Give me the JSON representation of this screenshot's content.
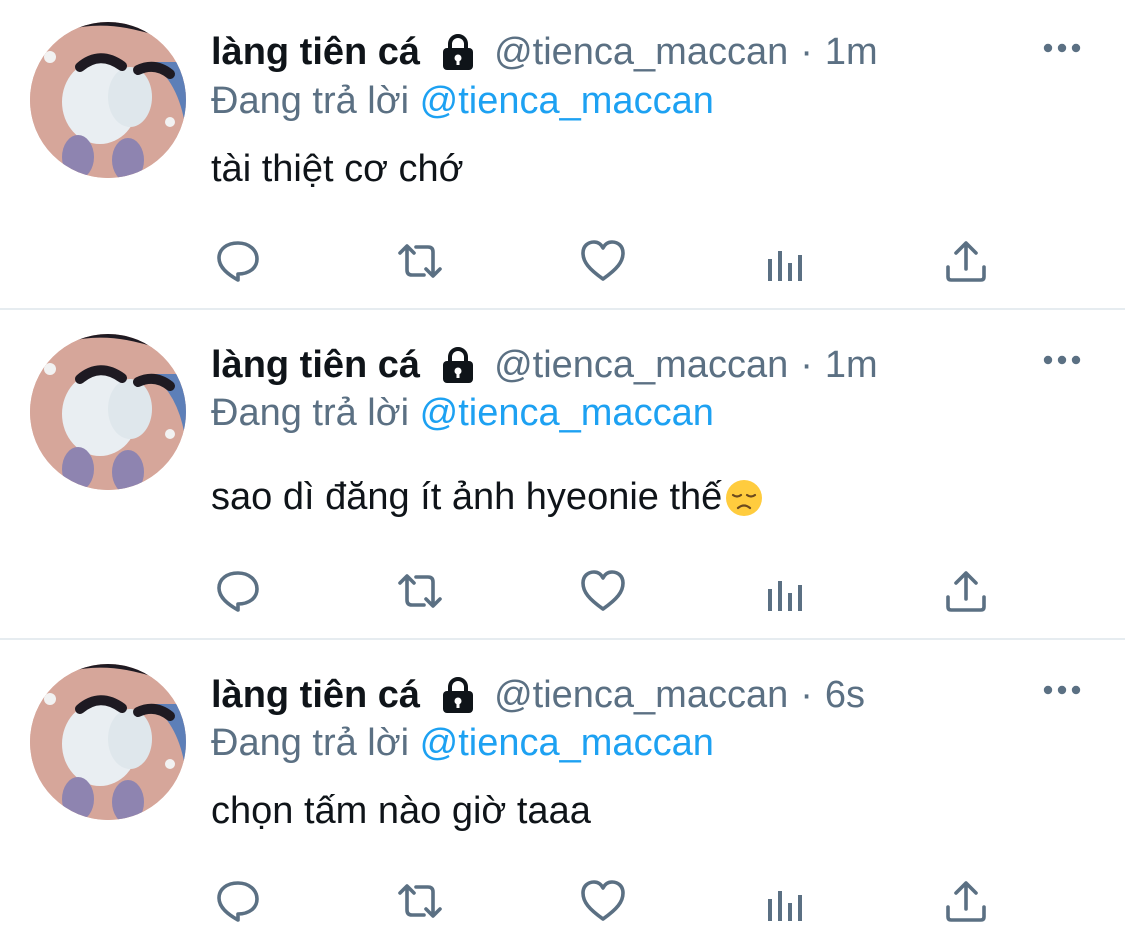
{
  "tweets": [
    {
      "display_name": "làng tiên cá",
      "handle": "@tienca_maccan",
      "separator": "·",
      "time": "1m",
      "reply_prefix": "Đang trả lời",
      "reply_to": "@tienca_maccan",
      "text": "tài thiệt cơ chớ",
      "emoji": null
    },
    {
      "display_name": "làng tiên cá",
      "handle": "@tienca_maccan",
      "separator": "·",
      "time": "1m",
      "reply_prefix": "Đang trả lời",
      "reply_to": "@tienca_maccan",
      "text": "sao dì đăng ít ảnh hyeonie thế",
      "emoji": "disappointed-face"
    },
    {
      "display_name": "làng tiên cá",
      "handle": "@tienca_maccan",
      "separator": "·",
      "time": "6s",
      "reply_prefix": "Đang trả lời",
      "reply_to": "@tienca_maccan",
      "text": "chọn tấm nào giờ taaa",
      "emoji": null
    }
  ],
  "icons": {
    "lock": "lock-icon",
    "more": "more-horizontal-icon",
    "reply": "reply-bubble-icon",
    "retweet": "retweet-icon",
    "like": "heart-icon",
    "views": "analytics-icon",
    "share": "share-icon"
  },
  "colors": {
    "text_primary": "#0f1419",
    "text_secondary": "#5b7083",
    "link": "#1da1f2",
    "divider": "#e6ecf0"
  }
}
